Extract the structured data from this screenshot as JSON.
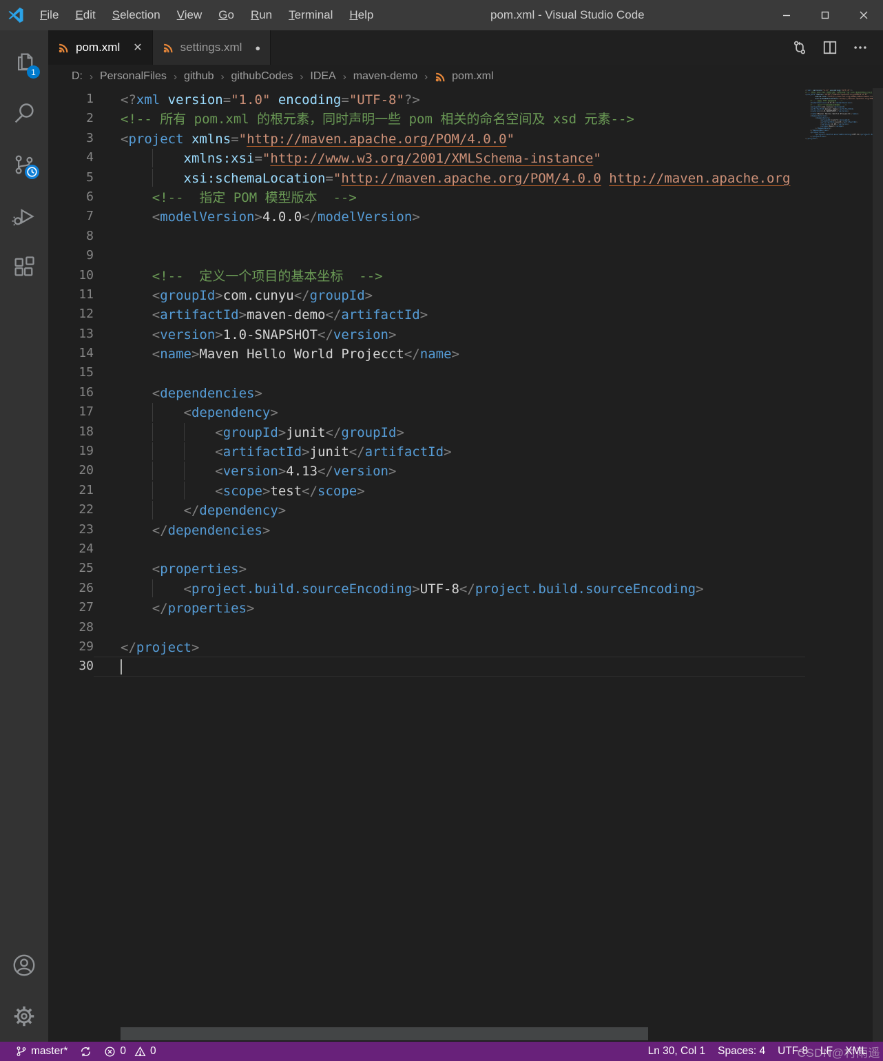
{
  "window": {
    "title": "pom.xml - Visual Studio Code",
    "menus": [
      "File",
      "Edit",
      "Selection",
      "View",
      "Go",
      "Run",
      "Terminal",
      "Help"
    ],
    "controls": [
      "minimize-icon",
      "maximize-icon",
      "close-icon"
    ]
  },
  "activity_bar": {
    "items": [
      {
        "icon": "explorer-icon",
        "badge": "1"
      },
      {
        "icon": "search-icon"
      },
      {
        "icon": "source-control-icon",
        "badge": "clock"
      },
      {
        "icon": "run-debug-icon"
      },
      {
        "icon": "extensions-icon"
      }
    ],
    "bottom": [
      {
        "icon": "account-icon"
      },
      {
        "icon": "settings-gear-icon"
      }
    ]
  },
  "tabs": [
    {
      "label": "pom.xml",
      "icon": "xml-file-icon",
      "state": "active"
    },
    {
      "label": "settings.xml",
      "icon": "xml-file-icon",
      "state": "modified"
    }
  ],
  "editor_actions": [
    "open-changes-icon",
    "split-editor-icon",
    "more-actions-icon"
  ],
  "breadcrumb": [
    "D:",
    "PersonalFiles",
    "github",
    "githubCodes",
    "IDEA",
    "maven-demo",
    "pom.xml"
  ],
  "editor": {
    "language": "xml",
    "cursor": {
      "line": 30,
      "col": 1
    },
    "lines": [
      [
        [
          "p",
          "<?"
        ],
        [
          "t",
          "xml"
        ],
        [
          "x",
          " "
        ],
        [
          "a",
          "version"
        ],
        [
          "p",
          "="
        ],
        [
          "s",
          "\"1.0\""
        ],
        [
          "x",
          " "
        ],
        [
          "a",
          "encoding"
        ],
        [
          "p",
          "="
        ],
        [
          "s",
          "\"UTF-8\""
        ],
        [
          "p",
          "?>"
        ]
      ],
      [
        [
          "c",
          "<!-- 所有 pom.xml 的根元素，同时声明一些 pom 相关的命名空间及 xsd 元素-->"
        ]
      ],
      [
        [
          "p",
          "<"
        ],
        [
          "t",
          "project"
        ],
        [
          "x",
          " "
        ],
        [
          "a",
          "xmlns"
        ],
        [
          "p",
          "="
        ],
        [
          "s",
          "\""
        ],
        [
          "u",
          "http://maven.apache.org/POM/4.0.0"
        ],
        [
          "s",
          "\""
        ]
      ],
      [
        [
          "x",
          "        "
        ],
        [
          "a",
          "xmlns:xsi"
        ],
        [
          "p",
          "="
        ],
        [
          "s",
          "\""
        ],
        [
          "u",
          "http://www.w3.org/2001/XMLSchema-instance"
        ],
        [
          "s",
          "\""
        ]
      ],
      [
        [
          "x",
          "        "
        ],
        [
          "a",
          "xsi:schemaLocation"
        ],
        [
          "p",
          "="
        ],
        [
          "s",
          "\""
        ],
        [
          "u",
          "http://maven.apache.org/POM/4.0.0"
        ],
        [
          "s",
          " "
        ],
        [
          "u",
          "http://maven.apache.org"
        ]
      ],
      [
        [
          "x",
          "    "
        ],
        [
          "c",
          "<!--  指定 POM 模型版本  -->"
        ]
      ],
      [
        [
          "x",
          "    "
        ],
        [
          "p",
          "<"
        ],
        [
          "t",
          "modelVersion"
        ],
        [
          "p",
          ">"
        ],
        [
          "x",
          "4.0.0"
        ],
        [
          "p",
          "</"
        ],
        [
          "t",
          "modelVersion"
        ],
        [
          "p",
          ">"
        ]
      ],
      [],
      [],
      [
        [
          "x",
          "    "
        ],
        [
          "c",
          "<!--  定义一个项目的基本坐标  -->"
        ]
      ],
      [
        [
          "x",
          "    "
        ],
        [
          "p",
          "<"
        ],
        [
          "t",
          "groupId"
        ],
        [
          "p",
          ">"
        ],
        [
          "x",
          "com.cunyu"
        ],
        [
          "p",
          "</"
        ],
        [
          "t",
          "groupId"
        ],
        [
          "p",
          ">"
        ]
      ],
      [
        [
          "x",
          "    "
        ],
        [
          "p",
          "<"
        ],
        [
          "t",
          "artifactId"
        ],
        [
          "p",
          ">"
        ],
        [
          "x",
          "maven-demo"
        ],
        [
          "p",
          "</"
        ],
        [
          "t",
          "artifactId"
        ],
        [
          "p",
          ">"
        ]
      ],
      [
        [
          "x",
          "    "
        ],
        [
          "p",
          "<"
        ],
        [
          "t",
          "version"
        ],
        [
          "p",
          ">"
        ],
        [
          "x",
          "1.0-SNAPSHOT"
        ],
        [
          "p",
          "</"
        ],
        [
          "t",
          "version"
        ],
        [
          "p",
          ">"
        ]
      ],
      [
        [
          "x",
          "    "
        ],
        [
          "p",
          "<"
        ],
        [
          "t",
          "name"
        ],
        [
          "p",
          ">"
        ],
        [
          "x",
          "Maven Hello World Projecct"
        ],
        [
          "p",
          "</"
        ],
        [
          "t",
          "name"
        ],
        [
          "p",
          ">"
        ]
      ],
      [],
      [
        [
          "x",
          "    "
        ],
        [
          "p",
          "<"
        ],
        [
          "t",
          "dependencies"
        ],
        [
          "p",
          ">"
        ]
      ],
      [
        [
          "x",
          "        "
        ],
        [
          "p",
          "<"
        ],
        [
          "t",
          "dependency"
        ],
        [
          "p",
          ">"
        ]
      ],
      [
        [
          "x",
          "            "
        ],
        [
          "p",
          "<"
        ],
        [
          "t",
          "groupId"
        ],
        [
          "p",
          ">"
        ],
        [
          "x",
          "junit"
        ],
        [
          "p",
          "</"
        ],
        [
          "t",
          "groupId"
        ],
        [
          "p",
          ">"
        ]
      ],
      [
        [
          "x",
          "            "
        ],
        [
          "p",
          "<"
        ],
        [
          "t",
          "artifactId"
        ],
        [
          "p",
          ">"
        ],
        [
          "x",
          "junit"
        ],
        [
          "p",
          "</"
        ],
        [
          "t",
          "artifactId"
        ],
        [
          "p",
          ">"
        ]
      ],
      [
        [
          "x",
          "            "
        ],
        [
          "p",
          "<"
        ],
        [
          "t",
          "version"
        ],
        [
          "p",
          ">"
        ],
        [
          "x",
          "4.13"
        ],
        [
          "p",
          "</"
        ],
        [
          "t",
          "version"
        ],
        [
          "p",
          ">"
        ]
      ],
      [
        [
          "x",
          "            "
        ],
        [
          "p",
          "<"
        ],
        [
          "t",
          "scope"
        ],
        [
          "p",
          ">"
        ],
        [
          "x",
          "test"
        ],
        [
          "p",
          "</"
        ],
        [
          "t",
          "scope"
        ],
        [
          "p",
          ">"
        ]
      ],
      [
        [
          "x",
          "        "
        ],
        [
          "p",
          "</"
        ],
        [
          "t",
          "dependency"
        ],
        [
          "p",
          ">"
        ]
      ],
      [
        [
          "x",
          "    "
        ],
        [
          "p",
          "</"
        ],
        [
          "t",
          "dependencies"
        ],
        [
          "p",
          ">"
        ]
      ],
      [],
      [
        [
          "x",
          "    "
        ],
        [
          "p",
          "<"
        ],
        [
          "t",
          "properties"
        ],
        [
          "p",
          ">"
        ]
      ],
      [
        [
          "x",
          "        "
        ],
        [
          "p",
          "<"
        ],
        [
          "t",
          "project.build.sourceEncoding"
        ],
        [
          "p",
          ">"
        ],
        [
          "x",
          "UTF-8"
        ],
        [
          "p",
          "</"
        ],
        [
          "t",
          "project.build.sourceEncoding"
        ],
        [
          "p",
          ">"
        ]
      ],
      [
        [
          "x",
          "    "
        ],
        [
          "p",
          "</"
        ],
        [
          "t",
          "properties"
        ],
        [
          "p",
          ">"
        ]
      ],
      [],
      [
        [
          "p",
          "</"
        ],
        [
          "t",
          "project"
        ],
        [
          "p",
          ">"
        ]
      ],
      []
    ]
  },
  "status_bar": {
    "branch": "master*",
    "errors": "0",
    "warnings": "0",
    "line_col": "Ln 30, Col 1",
    "indentation": "Spaces: 4",
    "encoding": "UTF-8",
    "eol": "LF",
    "language": "XML"
  },
  "watermark": "CSDN@村雨遥",
  "colors": {
    "accent": "#007acc",
    "status_bar": "#68217a",
    "xml_icon": "#e8883a",
    "tag": "#569cd6",
    "attribute": "#9cdcfe",
    "string": "#ce9178",
    "comment": "#6a9955"
  }
}
